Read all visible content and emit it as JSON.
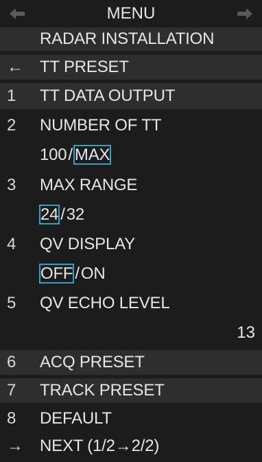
{
  "header": {
    "title": "MENU",
    "subtitle": "RADAR INSTALLATION"
  },
  "back_item": {
    "arrow": "←",
    "label": "TT PRESET"
  },
  "items": [
    {
      "num": "1",
      "label": "TT DATA OUTPUT"
    },
    {
      "num": "2",
      "label": "NUMBER OF TT"
    },
    {
      "num": "3",
      "label": "MAX RANGE"
    },
    {
      "num": "4",
      "label": "QV DISPLAY"
    },
    {
      "num": "5",
      "label": "QV ECHO LEVEL"
    },
    {
      "num": "6",
      "label": "ACQ PRESET"
    },
    {
      "num": "7",
      "label": "TRACK PRESET"
    },
    {
      "num": "8",
      "label": "DEFAULT"
    }
  ],
  "options": {
    "number_of_tt": {
      "first": "100",
      "second": "MAX",
      "selected": "MAX"
    },
    "max_range": {
      "first": "24",
      "second": "32",
      "selected": "24"
    },
    "qv_display": {
      "first": "OFF",
      "second": "ON",
      "selected": "OFF"
    },
    "option_separator": "/",
    "qv_echo_level_value": "13"
  },
  "next_item": {
    "arrow": "→",
    "label": "NEXT (1/2→2/2)"
  },
  "colors": {
    "background": "#1c1c1c",
    "bar": "#2e2e2e",
    "text": "#e6e6e6",
    "selection_outline": "#2ba3c4",
    "inactive_arrow": "#5a5a5a"
  },
  "icons": {
    "nav_left": "left-arrow-icon",
    "nav_right": "right-arrow-icon"
  }
}
